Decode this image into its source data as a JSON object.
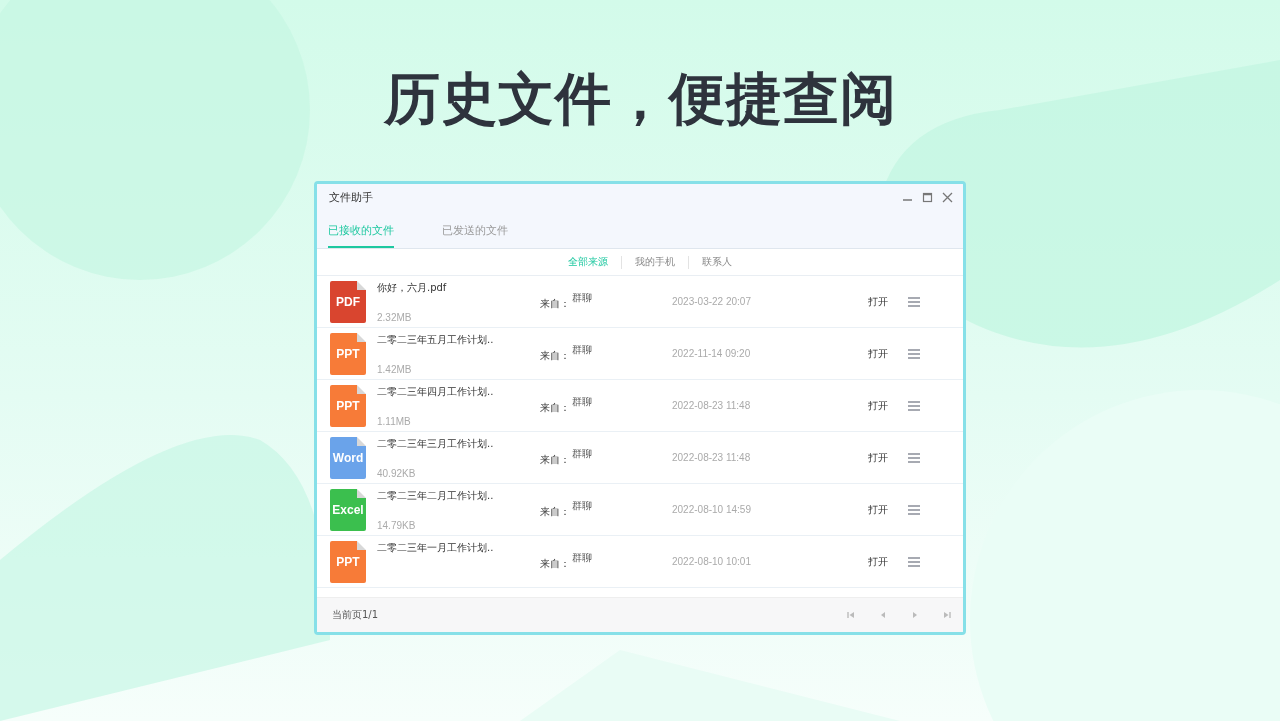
{
  "headline": "历史文件，便捷查阅",
  "window": {
    "title": "文件助手"
  },
  "tabs": [
    {
      "label": "已接收的文件",
      "selected": true
    },
    {
      "label": "已发送的文件",
      "selected": false
    }
  ],
  "filters": [
    {
      "label": "全部来源",
      "selected": true
    },
    {
      "label": "我的手机",
      "selected": false
    },
    {
      "label": "联系人",
      "selected": false
    }
  ],
  "files": [
    {
      "kind": "pdf",
      "icon_label": "PDF",
      "name": "你好，六月.pdf",
      "size": "2.32MB",
      "from_label": "来自：",
      "from": "群聊",
      "time": "2023-03-22 20:07",
      "action": "打开"
    },
    {
      "kind": "ppt",
      "icon_label": "PPT",
      "name": "二零二三年五月工作计划..",
      "size": "1.42MB",
      "from_label": "来自：",
      "from": "群聊",
      "time": "2022-11-14 09:20",
      "action": "打开"
    },
    {
      "kind": "ppt",
      "icon_label": "PPT",
      "name": "二零二三年四月工作计划..",
      "size": "1.11MB",
      "from_label": "来自：",
      "from": "群聊",
      "time": "2022-08-23 11:48",
      "action": "打开"
    },
    {
      "kind": "word",
      "icon_label": "Word",
      "name": "二零二三年三月工作计划..",
      "size": "40.92KB",
      "from_label": "来自：",
      "from": "群聊",
      "time": "2022-08-23 11:48",
      "action": "打开"
    },
    {
      "kind": "excel",
      "icon_label": "Excel",
      "name": "二零二三年二月工作计划..",
      "size": "14.79KB",
      "from_label": "来自：",
      "from": "群聊",
      "time": "2022-08-10 14:59",
      "action": "打开"
    },
    {
      "kind": "ppt",
      "icon_label": "PPT",
      "name": "二零二三年一月工作计划..",
      "from_label": "来自：",
      "from": "群聊",
      "time": "2022-08-10 10:01",
      "action": "打开"
    }
  ],
  "footer": {
    "page": "当前页1/1"
  }
}
